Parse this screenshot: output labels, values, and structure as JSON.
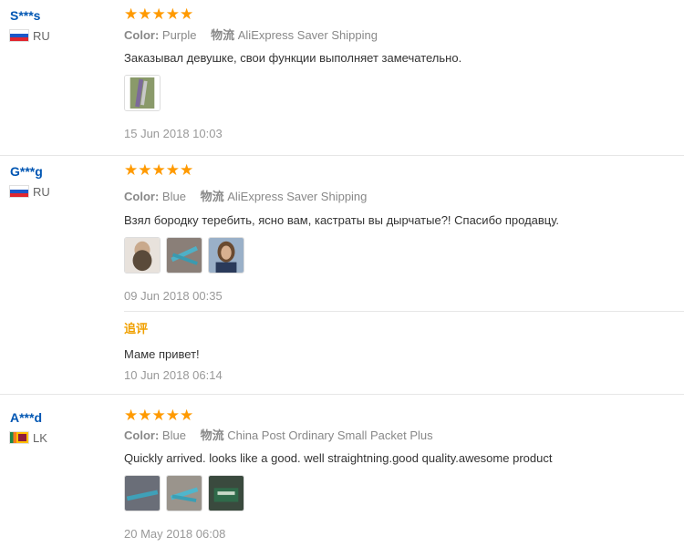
{
  "reviews": [
    {
      "user": "S***s",
      "country": "RU",
      "stars": "★★★★★",
      "color_label": "Color:",
      "color": "Purple",
      "shipping_label": "物流",
      "shipping": "AliExpress Saver Shipping",
      "text": "Заказывал девушке, свои функции выполняет замечательно.",
      "date": "15 Jun 2018 10:03"
    },
    {
      "user": "G***g",
      "country": "RU",
      "stars": "★★★★★",
      "color_label": "Color:",
      "color": "Blue",
      "shipping_label": "物流",
      "shipping": "AliExpress Saver Shipping",
      "text": "Взял бородку теребить, ясно вам, кастраты вы дырчатые?! Спасибо продавцу.",
      "date": "09 Jun 2018 00:35",
      "followup_label": "追评",
      "followup_text": "Маме привет!",
      "followup_date": "10 Jun 2018 06:14"
    },
    {
      "user": "A***d",
      "country": "LK",
      "stars": "★★★★★",
      "color_label": "Color:",
      "color": "Blue",
      "shipping_label": "物流",
      "shipping": "China Post Ordinary Small Packet Plus",
      "text": "Quickly arrived. looks like a good. well straightning.good quality.awesome product",
      "date": "20 May 2018 06:08"
    }
  ],
  "colors": {
    "star": "#ff9a00",
    "username": "#0056b3",
    "followup": "#f0a000"
  }
}
